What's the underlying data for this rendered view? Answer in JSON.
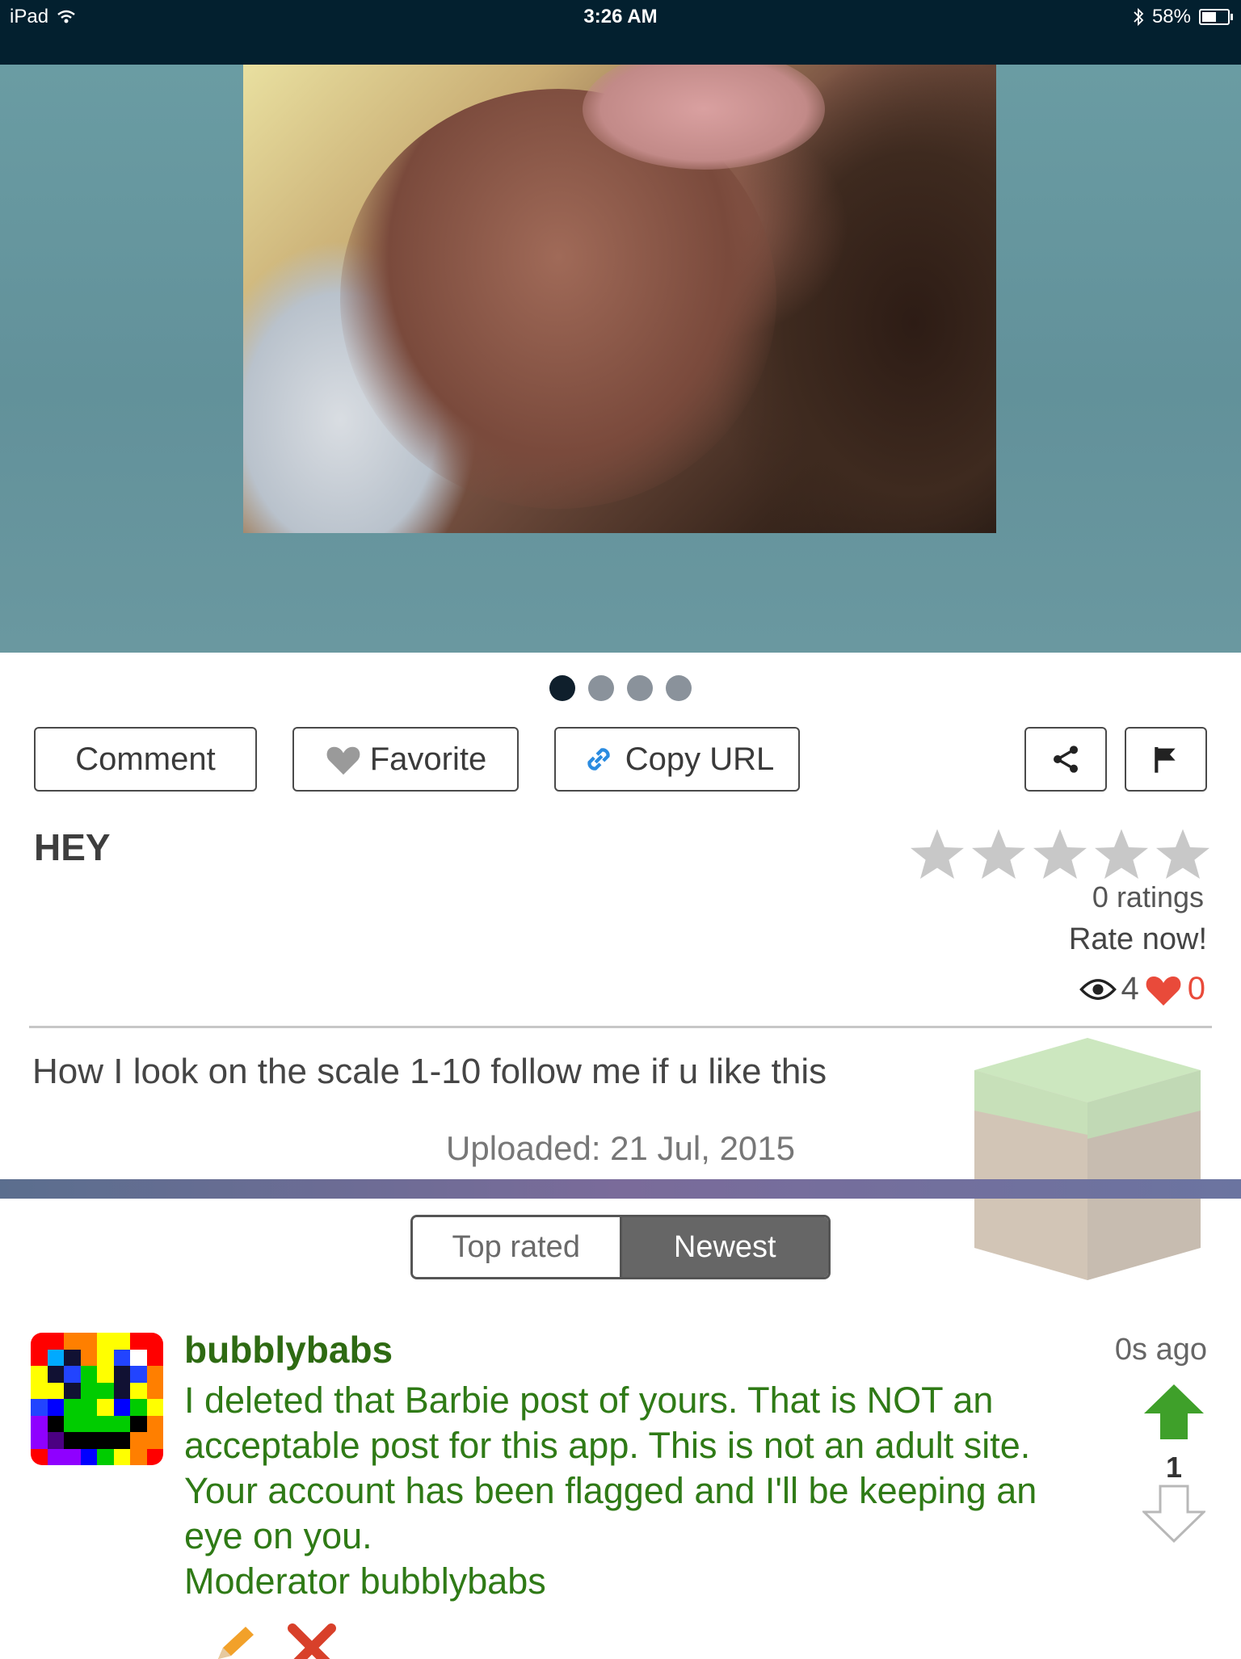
{
  "status_bar": {
    "device": "iPad",
    "time": "3:26 AM",
    "battery": "58%",
    "battery_level": 0.58,
    "icons": [
      "wifi-icon",
      "bluetooth-icon",
      "battery-icon"
    ]
  },
  "gallery": {
    "page_count": 4,
    "active_index": 0
  },
  "actions": {
    "comment_label": "Comment",
    "favorite_label": "Favorite",
    "copy_url_label": "Copy URL",
    "share_icon": "share-icon",
    "flag_icon": "flag-icon"
  },
  "post": {
    "title": "HEY",
    "rating_stars": 5,
    "rating_value": 0,
    "ratings_text": "0 ratings",
    "rate_now": "Rate now!",
    "views": "4",
    "likes": "0",
    "description": "How I look on the scale 1-10 follow me if u like this",
    "uploaded": "Uploaded: 21 Jul, 2015"
  },
  "sort_tabs": {
    "top_rated": "Top rated",
    "newest": "Newest",
    "selected": "Newest"
  },
  "comment": {
    "author": "bubblybabs",
    "time_ago": "0s ago",
    "lines": [
      "I deleted that Barbie post of yours. That is NOT an",
      "acceptable post for this app. This is not an adult site.",
      "Your account has been flagged and I'll be keeping an",
      "eye on you.",
      "Moderator bubblybabs"
    ],
    "votes": "1"
  },
  "colors": {
    "status_bar_bg": "#03202f",
    "hero_bg": "#6a9ca3",
    "author_green": "#2e6a12",
    "comment_green": "#2f7a16",
    "upvote_green": "#3fa02a",
    "likes_red": "#e94a3a",
    "selected_tab_bg": "#666666"
  }
}
